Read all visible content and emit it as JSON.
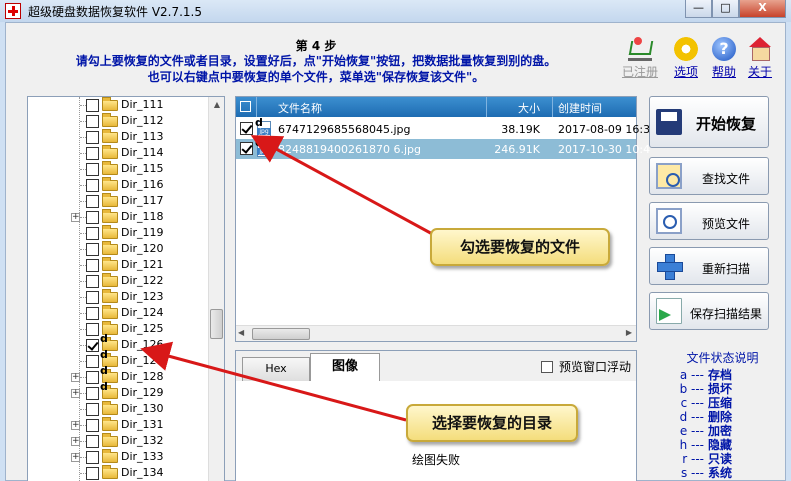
{
  "window": {
    "title": "超级硬盘数据恢复软件 V2.7.1.5",
    "controls": [
      "—",
      "□",
      "X"
    ]
  },
  "header": {
    "step": "第 4 步",
    "instruction_line1": "请勾上要恢复的文件或者目录，设置好后，点\"开始恢复\"按钮，把数据批量恢复到别的盘。",
    "instruction_line2": "也可以右键点中要恢复的单个文件，菜单选\"保存恢复该文件\"。"
  },
  "toolbar": {
    "registered": "已注册",
    "options": "选项",
    "help": "帮助",
    "about": "关于",
    "help_glyph": "?"
  },
  "tree": {
    "items": [
      {
        "label": "Dir_111",
        "expandable": false,
        "checked": false,
        "marked": false
      },
      {
        "label": "Dir_112",
        "expandable": false,
        "checked": false,
        "marked": false
      },
      {
        "label": "Dir_113",
        "expandable": false,
        "checked": false,
        "marked": false
      },
      {
        "label": "Dir_114",
        "expandable": false,
        "checked": false,
        "marked": false
      },
      {
        "label": "Dir_115",
        "expandable": false,
        "checked": false,
        "marked": false
      },
      {
        "label": "Dir_116",
        "expandable": false,
        "checked": false,
        "marked": false
      },
      {
        "label": "Dir_117",
        "expandable": false,
        "checked": false,
        "marked": false
      },
      {
        "label": "Dir_118",
        "expandable": true,
        "checked": false,
        "marked": false
      },
      {
        "label": "Dir_119",
        "expandable": false,
        "checked": false,
        "marked": false
      },
      {
        "label": "Dir_120",
        "expandable": false,
        "checked": false,
        "marked": false
      },
      {
        "label": "Dir_121",
        "expandable": false,
        "checked": false,
        "marked": false
      },
      {
        "label": "Dir_122",
        "expandable": false,
        "checked": false,
        "marked": false
      },
      {
        "label": "Dir_123",
        "expandable": false,
        "checked": false,
        "marked": false
      },
      {
        "label": "Dir_124",
        "expandable": false,
        "checked": false,
        "marked": false
      },
      {
        "label": "Dir_125",
        "expandable": false,
        "checked": false,
        "marked": false
      },
      {
        "label": "Dir_126",
        "expandable": false,
        "checked": true,
        "marked": true
      },
      {
        "label": "Dir_127",
        "expandable": false,
        "checked": false,
        "marked": true
      },
      {
        "label": "Dir_128",
        "expandable": true,
        "checked": false,
        "marked": true
      },
      {
        "label": "Dir_129",
        "expandable": true,
        "checked": false,
        "marked": true
      },
      {
        "label": "Dir_130",
        "expandable": false,
        "checked": false,
        "marked": false
      },
      {
        "label": "Dir_131",
        "expandable": true,
        "checked": false,
        "marked": false
      },
      {
        "label": "Dir_132",
        "expandable": true,
        "checked": false,
        "marked": false
      },
      {
        "label": "Dir_133",
        "expandable": true,
        "checked": false,
        "marked": false
      },
      {
        "label": "Dir_134",
        "expandable": false,
        "checked": false,
        "marked": false
      }
    ],
    "mark_glyph": "d"
  },
  "filelist": {
    "columns": {
      "name": "文件名称",
      "size": "大小",
      "created": "创建时间"
    },
    "rows": [
      {
        "name": "6747129685568045.jpg",
        "size": "38.19K",
        "created": "2017-08-09 16:3",
        "checked": true,
        "selected": false
      },
      {
        "name": "8248819400261870 6.jpg",
        "size": "246.91K",
        "created": "2017-10-30 10:4",
        "checked": true,
        "selected": true
      }
    ]
  },
  "preview": {
    "tab_hex": "Hex",
    "tab_image": "图像",
    "float_option": "预览窗口浮动",
    "render_failed": "绘图失败"
  },
  "actions": {
    "start_recover": "开始恢复",
    "find_file": "查找文件",
    "preview_file": "预览文件",
    "rescan": "重新扫描",
    "save_scan": "保存扫描结果"
  },
  "legend": {
    "title": "文件状态说明",
    "items": [
      {
        "code": "a ---",
        "name": "存档"
      },
      {
        "code": "b ---",
        "name": "损坏"
      },
      {
        "code": "c ---",
        "name": "压缩"
      },
      {
        "code": "d ---",
        "name": "删除"
      },
      {
        "code": "e ---",
        "name": "加密"
      },
      {
        "code": "h ---",
        "name": "隐藏"
      },
      {
        "code": "r ---",
        "name": "只读"
      },
      {
        "code": "s ---",
        "name": "系统"
      }
    ]
  },
  "callouts": {
    "check_files": "勾选要恢复的文件",
    "select_dir": "选择要恢复的目录"
  },
  "colors": {
    "instruction_blue": "#0015a8",
    "header_blue": "#1e6cb2",
    "selected_row": "#8dbcd6",
    "arrow_red": "#d81818"
  }
}
